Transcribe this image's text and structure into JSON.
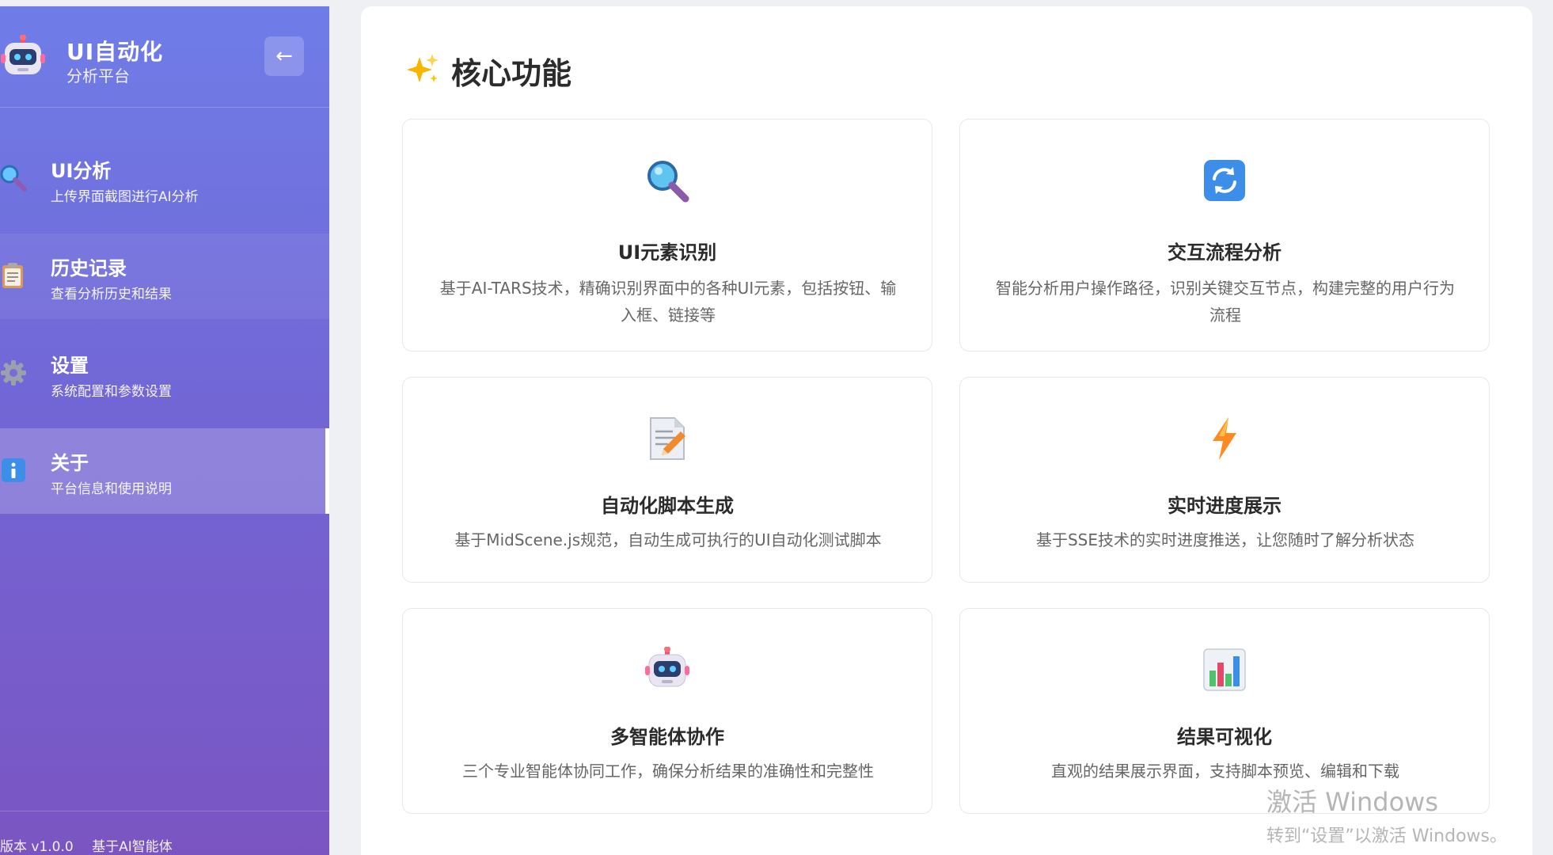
{
  "sidebar": {
    "brand_title": "UI自动化",
    "brand_subtitle": "分析平台",
    "collapse_label": "←",
    "items": [
      {
        "label": "UI分析",
        "desc": "上传界面截图进行AI分析",
        "icon": "magnifier-icon"
      },
      {
        "label": "历史记录",
        "desc": "查看分析历史和结果",
        "icon": "clipboard-icon"
      },
      {
        "label": "设置",
        "desc": "系统配置和参数设置",
        "icon": "gear-icon"
      },
      {
        "label": "关于",
        "desc": "平台信息和使用说明",
        "icon": "info-icon"
      }
    ],
    "active_index": 3,
    "footer": {
      "version": "版本 v1.0.0",
      "powered": "基于AI智能体"
    }
  },
  "main": {
    "section_title": "核心功能",
    "features": [
      {
        "title": "UI元素识别",
        "desc": "基于AI-TARS技术，精确识别界面中的各种UI元素，包括按钮、输入框、链接等",
        "icon": "magnifier-icon"
      },
      {
        "title": "交互流程分析",
        "desc": "智能分析用户操作路径，识别关键交互节点，构建完整的用户行为流程",
        "icon": "refresh-icon"
      },
      {
        "title": "自动化脚本生成",
        "desc": "基于MidScene.js规范，自动生成可执行的UI自动化测试脚本",
        "icon": "document-edit-icon"
      },
      {
        "title": "实时进度展示",
        "desc": "基于SSE技术的实时进度推送，让您随时了解分析状态",
        "icon": "lightning-icon"
      },
      {
        "title": "多智能体协作",
        "desc": "三个专业智能体协同工作，确保分析结果的准确性和完整性",
        "icon": "robot-icon"
      },
      {
        "title": "结果可视化",
        "desc": "直观的结果展示界面，支持脚本预览、编辑和下载",
        "icon": "bar-chart-icon"
      }
    ]
  },
  "watermark": {
    "title": "激活 Windows",
    "subtitle": "转到“设置”以激活 Windows。"
  }
}
